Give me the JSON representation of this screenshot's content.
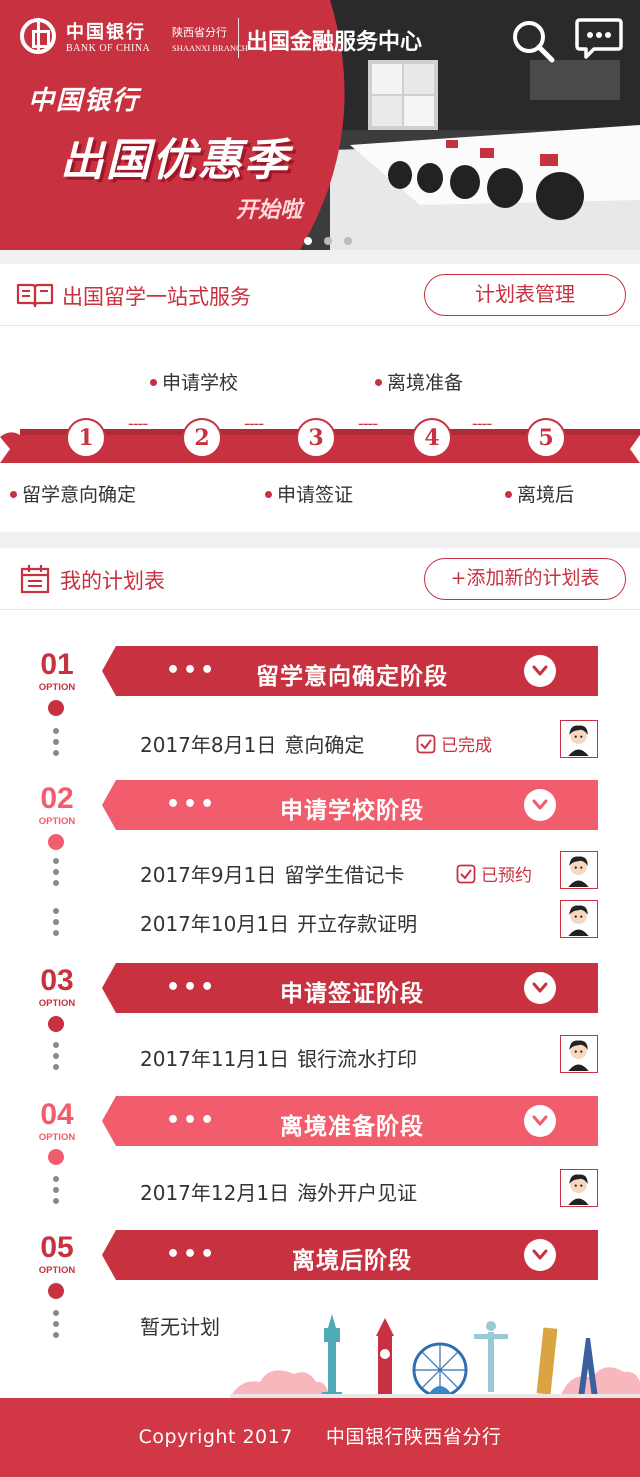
{
  "colors": {
    "brand_red": "#c8313f",
    "light_red": "#f15d6c",
    "footer_red": "#d13745"
  },
  "header": {
    "logo_cn": "中国银行",
    "logo_en": "BANK OF CHINA",
    "branch_cn": "陕西省分行",
    "branch_en": "SHAANXI BRANCH",
    "center_title": "出国金融服务中心",
    "icons": [
      "search-icon",
      "message-icon"
    ]
  },
  "banner": {
    "brand": "中国银行",
    "title": "出国优惠季",
    "subtitle": "开始啦",
    "slide_count": 3,
    "active_slide": 0
  },
  "study_service": {
    "title": "出国留学一站式服务",
    "button": "计划表管理",
    "steps": [
      {
        "num": "1",
        "label": "留学意向确定"
      },
      {
        "num": "2",
        "label": "申请学校"
      },
      {
        "num": "3",
        "label": "申请签证"
      },
      {
        "num": "4",
        "label": "离境准备"
      },
      {
        "num": "5",
        "label": "离境后"
      }
    ],
    "connector": "----"
  },
  "my_plans": {
    "title": "我的计划表",
    "button": "+添加新的计划表",
    "option_label": "OPTION",
    "banner_dots": "•••",
    "phases": [
      {
        "num": "01",
        "title": "留学意向确定阶段",
        "color": "#c8313f",
        "tasks": [
          {
            "date": "2017年8月1日",
            "name": "意向确定",
            "status": "已完成"
          }
        ]
      },
      {
        "num": "02",
        "title": "申请学校阶段",
        "color": "#f15d6c",
        "tasks": [
          {
            "date": "2017年9月1日",
            "name": "留学生借记卡",
            "status": "已预约"
          },
          {
            "date": "2017年10月1日",
            "name": "开立存款证明"
          }
        ]
      },
      {
        "num": "03",
        "title": "申请签证阶段",
        "color": "#c8313f",
        "tasks": [
          {
            "date": "2017年11月1日",
            "name": "银行流水打印"
          }
        ]
      },
      {
        "num": "04",
        "title": "离境准备阶段",
        "color": "#f15d6c",
        "tasks": [
          {
            "date": "2017年12月1日",
            "name": "海外开户见证"
          }
        ]
      },
      {
        "num": "05",
        "title": "离境后阶段",
        "color": "#c8313f",
        "tasks": [
          {
            "name": "暂无计划"
          }
        ]
      }
    ]
  },
  "footer": {
    "copyright": "Copyright 2017",
    "org": "中国银行陕西省分行"
  }
}
